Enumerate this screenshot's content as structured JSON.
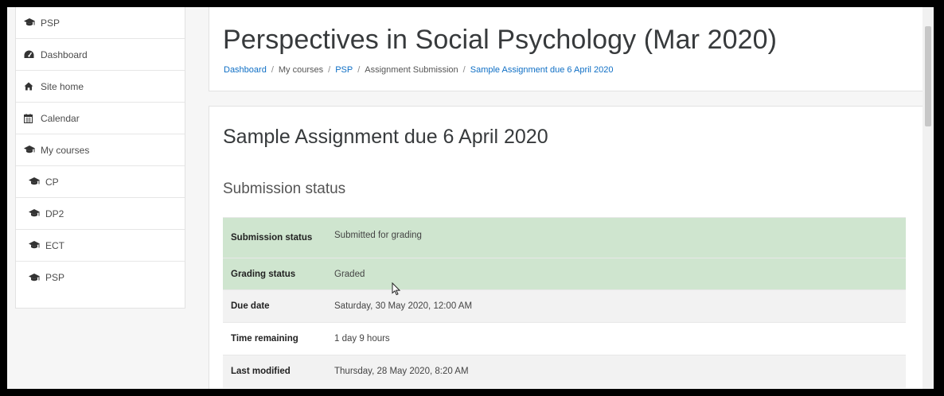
{
  "sidebar": {
    "items": [
      {
        "label": "PSP",
        "icon": "graduation-cap-icon"
      },
      {
        "label": "Dashboard",
        "icon": "dashboard-icon"
      },
      {
        "label": "Site home",
        "icon": "home-icon"
      },
      {
        "label": "Calendar",
        "icon": "calendar-icon"
      },
      {
        "label": "My courses",
        "icon": "graduation-cap-icon"
      },
      {
        "label": "CP",
        "icon": "graduation-cap-icon"
      },
      {
        "label": "DP2",
        "icon": "graduation-cap-icon"
      },
      {
        "label": "ECT",
        "icon": "graduation-cap-icon"
      },
      {
        "label": "PSP",
        "icon": "graduation-cap-icon"
      }
    ]
  },
  "header": {
    "title": "Perspectives in Social Psychology (Mar 2020)",
    "breadcrumb": [
      "Dashboard",
      "My courses",
      "PSP",
      "Assignment Submission",
      "Sample Assignment due 6 April 2020"
    ],
    "separator": "/"
  },
  "assignment": {
    "title": "Sample Assignment due 6 April 2020",
    "section_heading": "Submission status",
    "rows": [
      {
        "label": "Submission status",
        "value": "Submitted for grading"
      },
      {
        "label": "Grading status",
        "value": "Graded"
      },
      {
        "label": "Due date",
        "value": "Saturday, 30 May 2020, 12:00 AM"
      },
      {
        "label": "Time remaining",
        "value": "1 day 9 hours"
      },
      {
        "label": "Last modified",
        "value": "Thursday, 28 May 2020, 8:20 AM"
      }
    ]
  },
  "colors": {
    "link": "#0f6fc5",
    "submitted_row": "#cfe5cf",
    "alt_row": "#f2f2f2"
  }
}
